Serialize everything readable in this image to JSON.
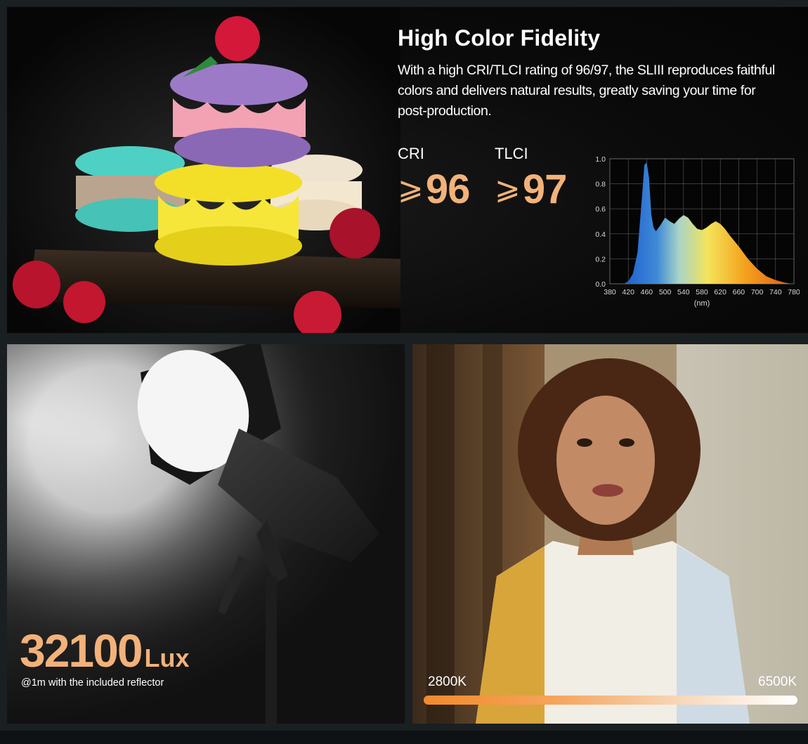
{
  "top": {
    "headline": "High Color Fidelity",
    "description": "With a high CRI/TLCI rating of 96/97, the SLIII reproduces faithful colors and delivers natural results, greatly saving  your time for post-production.",
    "cri": {
      "label": "CRI",
      "symbol": "⩾",
      "value": "96"
    },
    "tlci": {
      "label": "TLCI",
      "symbol": "⩾",
      "value": "97"
    }
  },
  "chart_data": {
    "type": "area",
    "title": "",
    "xlabel": "(nm)",
    "ylabel": "",
    "x_ticks": [
      "380",
      "420",
      "460",
      "500",
      "540",
      "580",
      "620",
      "660",
      "700",
      "740",
      "780"
    ],
    "y_ticks": [
      "0.0",
      "0.2",
      "0.4",
      "0.6",
      "0.8",
      "1.0"
    ],
    "xlim": [
      380,
      780
    ],
    "ylim": [
      0,
      1.0
    ],
    "grid": true,
    "x": [
      410,
      420,
      430,
      440,
      450,
      455,
      460,
      465,
      470,
      475,
      480,
      490,
      500,
      510,
      520,
      530,
      540,
      550,
      560,
      570,
      580,
      590,
      600,
      610,
      620,
      630,
      640,
      660,
      680,
      700,
      720,
      740,
      760,
      775
    ],
    "values": [
      0.0,
      0.02,
      0.08,
      0.25,
      0.7,
      0.95,
      0.97,
      0.85,
      0.55,
      0.45,
      0.42,
      0.47,
      0.53,
      0.5,
      0.48,
      0.52,
      0.55,
      0.53,
      0.48,
      0.44,
      0.43,
      0.45,
      0.48,
      0.5,
      0.48,
      0.44,
      0.39,
      0.3,
      0.2,
      0.12,
      0.06,
      0.03,
      0.01,
      0.0
    ]
  },
  "lux": {
    "value": "32100",
    "unit": "Lux",
    "note": "@1m with the included reflector"
  },
  "cct": {
    "min_label": "2800K",
    "max_label": "6500K"
  },
  "colors": {
    "accent": "#f2b27a",
    "background": "#0b0b0b"
  }
}
